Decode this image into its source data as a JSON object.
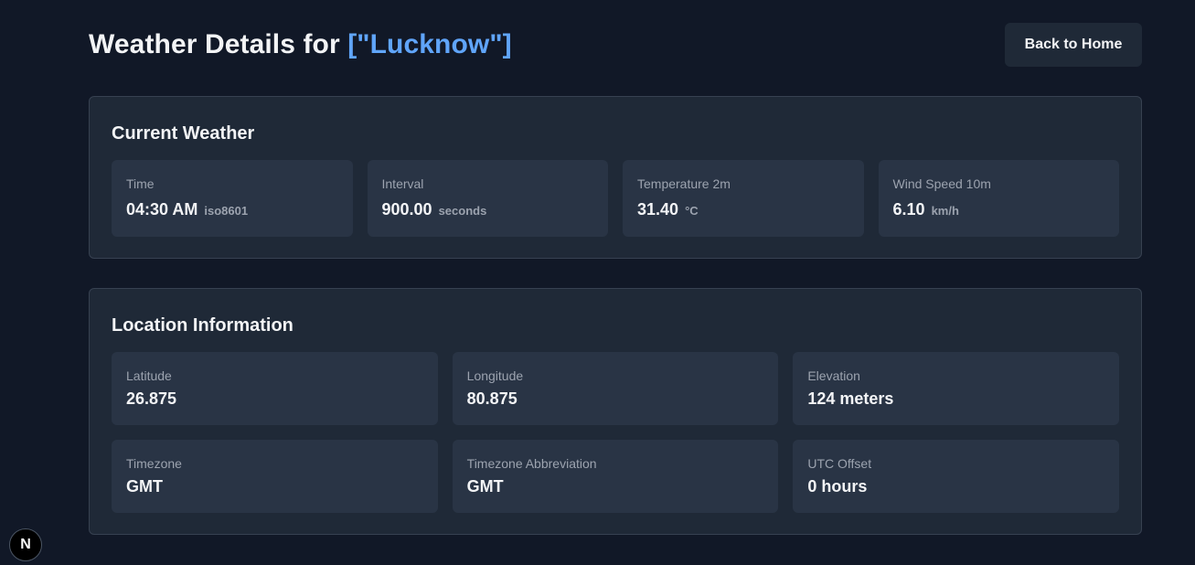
{
  "header": {
    "title_prefix": "Weather Details for ",
    "city": "[\"Lucknow\"]",
    "back_button": "Back to Home"
  },
  "current_weather": {
    "title": "Current Weather",
    "items": [
      {
        "label": "Time",
        "value": "04:30 AM",
        "unit": "iso8601"
      },
      {
        "label": "Interval",
        "value": "900.00",
        "unit": "seconds"
      },
      {
        "label": "Temperature 2m",
        "value": "31.40",
        "unit": "°C"
      },
      {
        "label": "Wind Speed 10m",
        "value": "6.10",
        "unit": "km/h"
      }
    ]
  },
  "location": {
    "title": "Location Information",
    "items": [
      {
        "label": "Latitude",
        "value": "26.875"
      },
      {
        "label": "Longitude",
        "value": "80.875"
      },
      {
        "label": "Elevation",
        "value": "124 meters"
      },
      {
        "label": "Timezone",
        "value": "GMT"
      },
      {
        "label": "Timezone Abbreviation",
        "value": "GMT"
      },
      {
        "label": "UTC Offset",
        "value": "0 hours"
      }
    ]
  },
  "badge": {
    "letter": "N",
    "icon": "nextjs-logo-icon"
  },
  "colors": {
    "background": "#111827",
    "card": "#1f2937",
    "tile": "#293445",
    "accent": "#60a5fa"
  }
}
